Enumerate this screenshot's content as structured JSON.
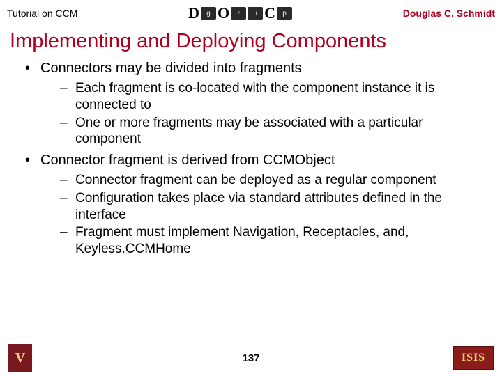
{
  "header": {
    "left": "Tutorial on CCM",
    "right": "Douglas C. Schmidt",
    "logo_letters": [
      "D",
      "O",
      "C"
    ],
    "logo_boxes": [
      "g",
      "r",
      "u",
      "p"
    ]
  },
  "title": "Implementing and Deploying Components",
  "bullets": [
    {
      "text": "Connectors may be divided into fragments",
      "sub": [
        "Each fragment is co-located with the component instance it is connected to",
        "One or more fragments may be associated with a particular component"
      ]
    },
    {
      "text": "Connector fragment is derived from CCMObject",
      "sub": [
        "Connector fragment can be deployed as a regular component",
        "Configuration takes place via standard attributes defined in the interface",
        "Fragment must implement Navigation, Receptacles, and, Keyless.CCMHome"
      ]
    }
  ],
  "footer": {
    "page": "137",
    "right_logo_text": "ISIS"
  }
}
